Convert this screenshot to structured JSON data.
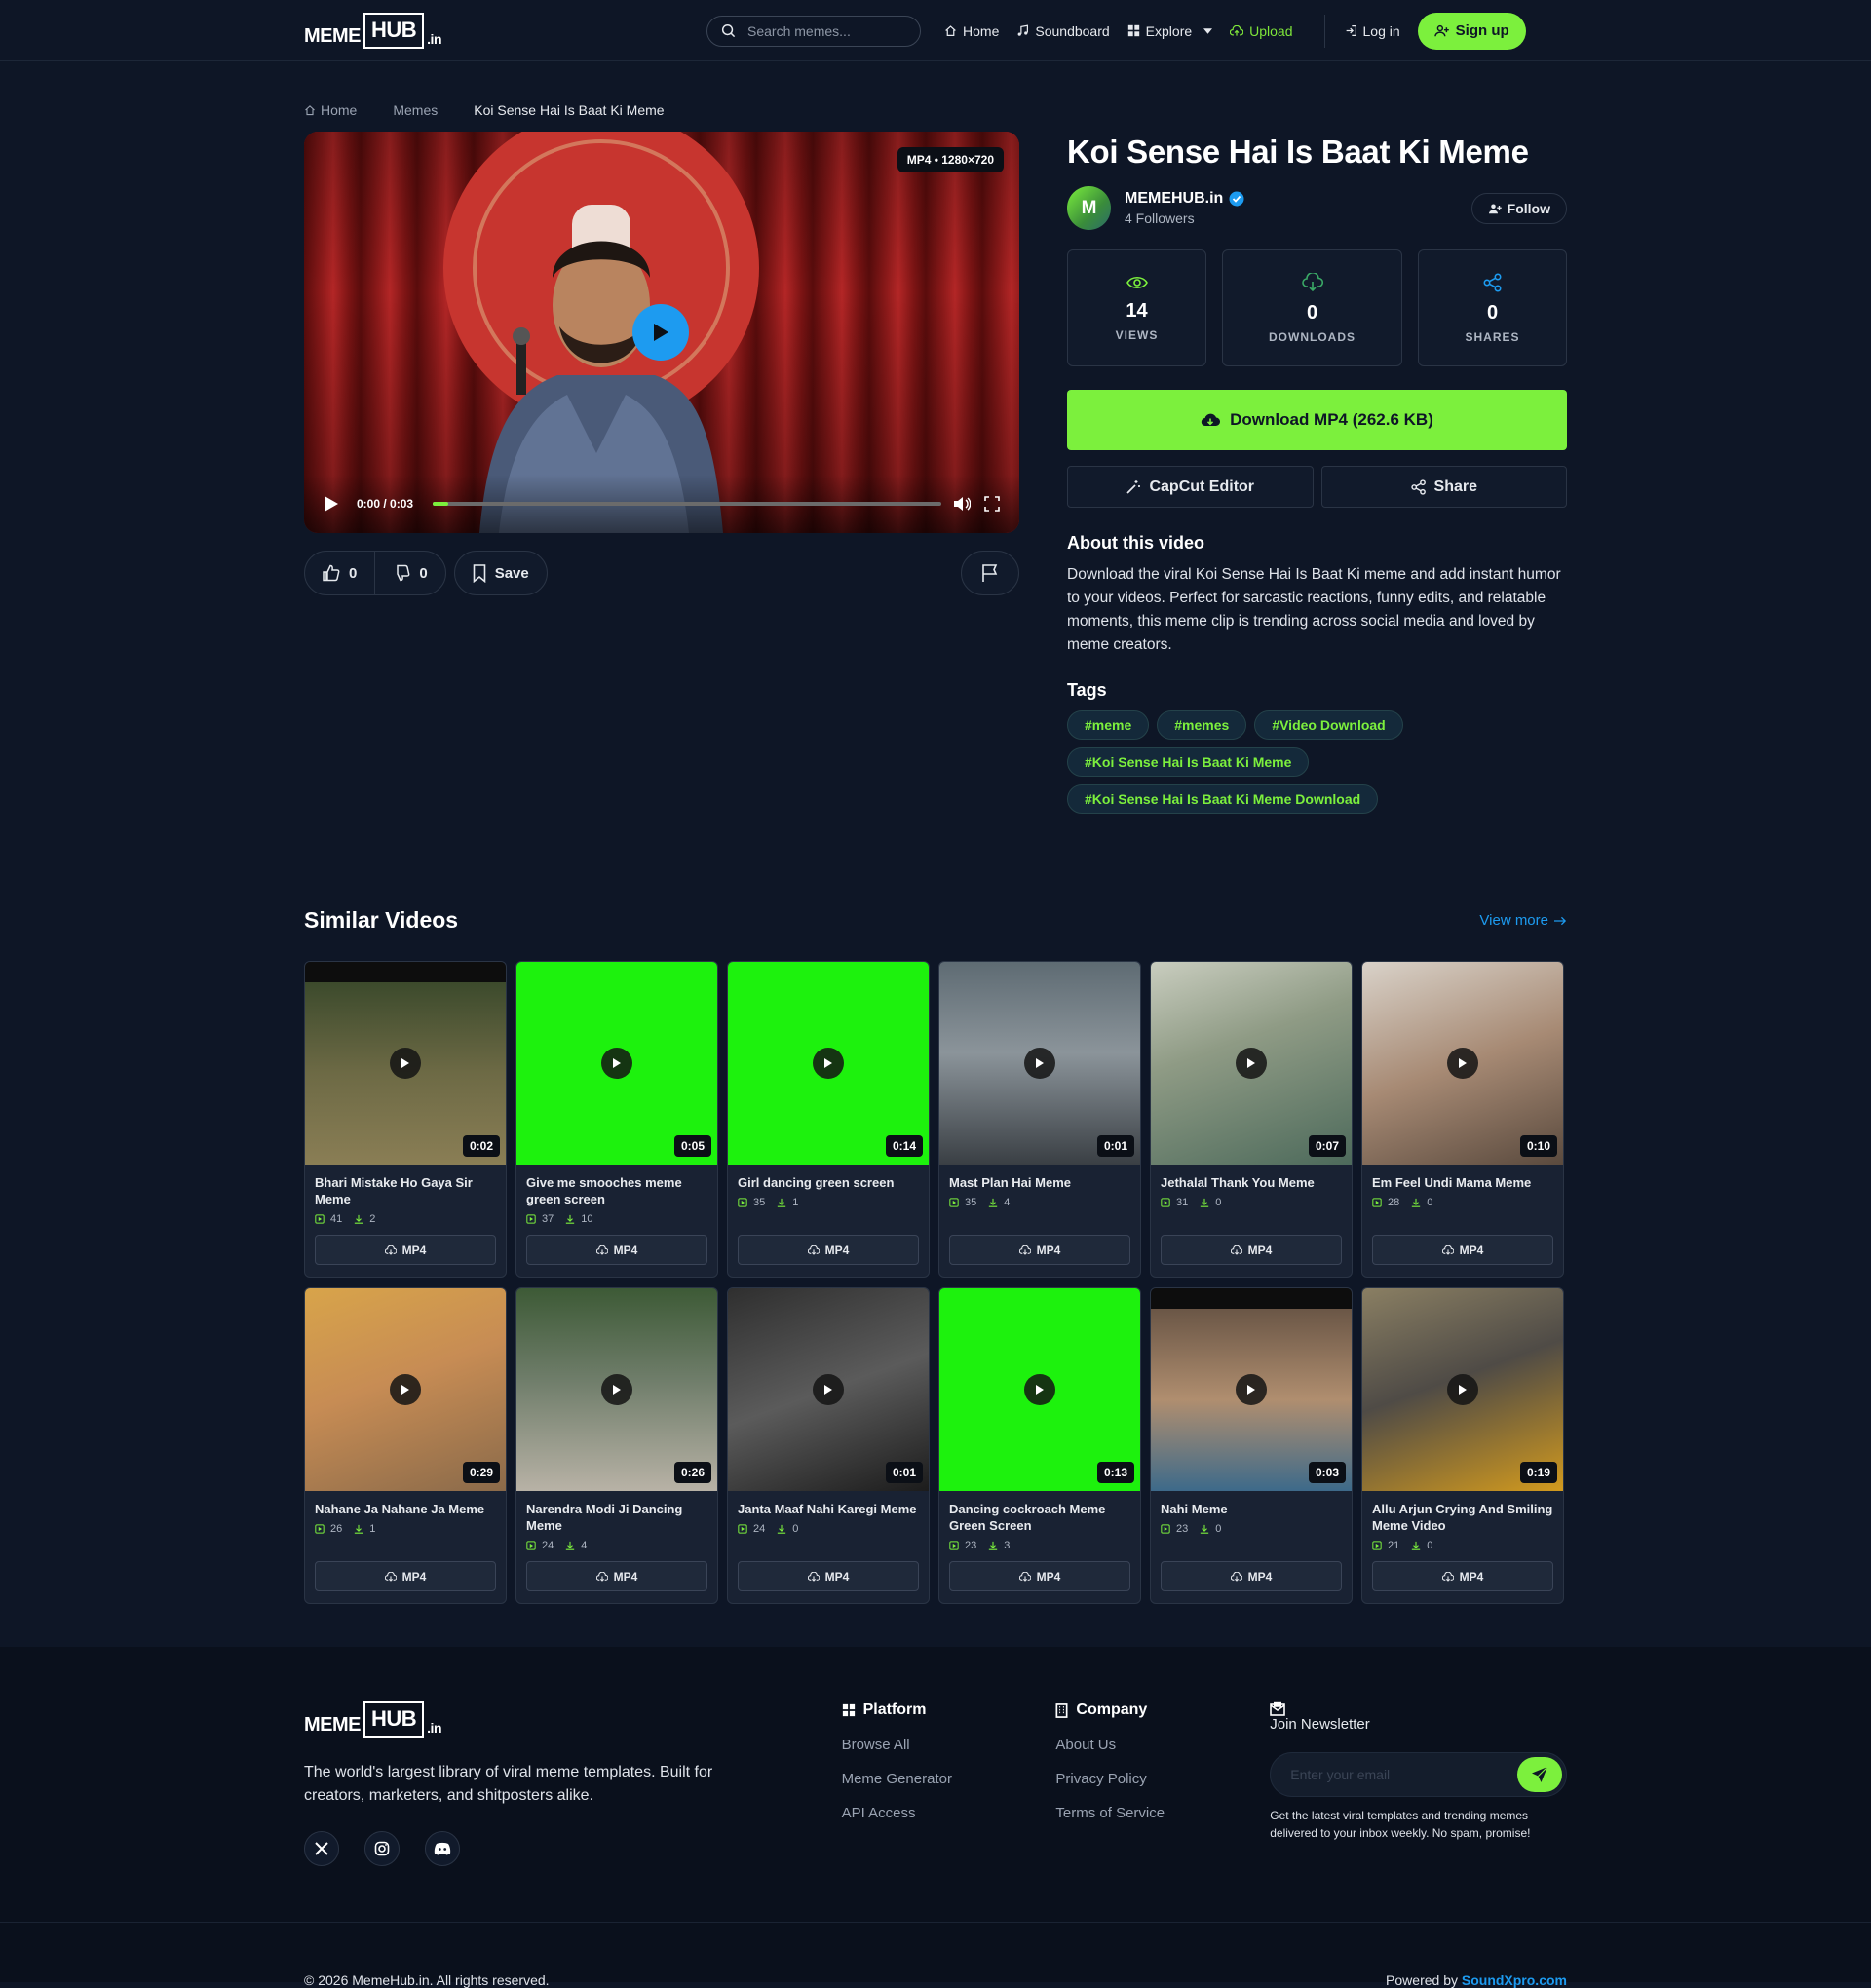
{
  "header": {
    "logo": {
      "meme": "MEME",
      "hub": "HUB",
      "tld": ".in"
    },
    "search_placeholder": "Search memes...",
    "nav": {
      "home": "Home",
      "soundboard": "Soundboard",
      "explore": "Explore",
      "upload": "Upload"
    },
    "login": "Log in",
    "signup": "Sign up"
  },
  "breadcrumb": {
    "home": "Home",
    "memes": "Memes",
    "current": "Koi Sense Hai Is Baat Ki Meme"
  },
  "player": {
    "format_badge": "MP4 • 1280×720",
    "time": "0:00 / 0:03",
    "progress": 0.03
  },
  "actions": {
    "likes": "0",
    "dislikes": "0",
    "save": "Save"
  },
  "video": {
    "title": "Koi Sense Hai Is Baat Ki Meme",
    "author": {
      "initial": "M",
      "name": "MEMEHUB.in",
      "followers": "4 Followers",
      "follow": "Follow"
    },
    "stats": [
      {
        "value": "14",
        "label": "VIEWS"
      },
      {
        "value": "0",
        "label": "DOWNLOADS"
      },
      {
        "value": "0",
        "label": "SHARES"
      }
    ],
    "download": "Download MP4 (262.6 KB)",
    "capcut": "CapCut Editor",
    "share": "Share",
    "about_title": "About this video",
    "about_text": "Download the viral Koi Sense Hai Is Baat Ki meme and add instant humor to your videos. Perfect for sarcastic reactions, funny edits, and relatable moments, this meme clip is trending across social media and loved by meme creators.",
    "tags_title": "Tags",
    "tags": [
      "#meme",
      "#memes",
      "#Video Download",
      "#Koi Sense Hai Is Baat Ki Meme",
      "#Koi Sense Hai Is Baat Ki Meme Download"
    ]
  },
  "similar": {
    "title": "Similar Videos",
    "view_more": "View more",
    "download_label": "MP4",
    "items": [
      {
        "title": "Bhari Mistake Ho Gaya Sir Meme",
        "views": "41",
        "downloads": "2",
        "duration": "0:02",
        "theme": "forest"
      },
      {
        "title": "Give me smooches meme green screen",
        "views": "37",
        "downloads": "10",
        "duration": "0:05",
        "theme": "green"
      },
      {
        "title": "Girl dancing green screen",
        "views": "35",
        "downloads": "1",
        "duration": "0:14",
        "theme": "green"
      },
      {
        "title": "Mast Plan Hai Meme",
        "views": "35",
        "downloads": "4",
        "duration": "0:01",
        "theme": "street"
      },
      {
        "title": "Jethalal Thank You Meme",
        "views": "31",
        "downloads": "0",
        "duration": "0:07",
        "theme": "car"
      },
      {
        "title": "Em Feel Undi Mama Meme",
        "views": "28",
        "downloads": "0",
        "duration": "0:10",
        "theme": "skin"
      },
      {
        "title": "Nahane Ja Nahane Ja Meme",
        "views": "26",
        "downloads": "1",
        "duration": "0:29",
        "theme": "warm"
      },
      {
        "title": "Narendra Modi Ji Dancing Meme",
        "views": "24",
        "downloads": "4",
        "duration": "0:26",
        "theme": "crowd"
      },
      {
        "title": "Janta Maaf Nahi Karegi Meme",
        "views": "24",
        "downloads": "0",
        "duration": "0:01",
        "theme": "dark"
      },
      {
        "title": "Dancing cockroach Meme Green Screen",
        "views": "23",
        "downloads": "3",
        "duration": "0:13",
        "theme": "green"
      },
      {
        "title": "Nahi Meme",
        "views": "23",
        "downloads": "0",
        "duration": "0:03",
        "theme": "room"
      },
      {
        "title": "Allu Arjun Crying And Smiling Meme Video",
        "views": "21",
        "downloads": "0",
        "duration": "0:19",
        "theme": "yellow"
      }
    ]
  },
  "footer": {
    "logo": {
      "meme": "MEME",
      "hub": "HUB",
      "tld": ".in"
    },
    "description": "The world's largest library of viral meme templates. Built for creators, marketers, and shitposters alike.",
    "platform": {
      "title": "Platform",
      "links": [
        "Browse All",
        "Meme Generator",
        "API Access"
      ]
    },
    "company": {
      "title": "Company",
      "links": [
        "About Us",
        "Privacy Policy",
        "Terms of Service"
      ]
    },
    "newsletter": {
      "title": "Join Newsletter",
      "placeholder": "Enter your email",
      "note": "Get the latest viral templates and trending memes delivered to your inbox weekly. No spam, promise!"
    },
    "copyright": "© 2026 MemeHub.in. All rights reserved.",
    "powered_prefix": "Powered by",
    "powered_link": "SoundXpro.com"
  },
  "colors": {
    "accent": "#7cf03d",
    "link": "#1d9bf0",
    "bg": "#0e1626"
  }
}
